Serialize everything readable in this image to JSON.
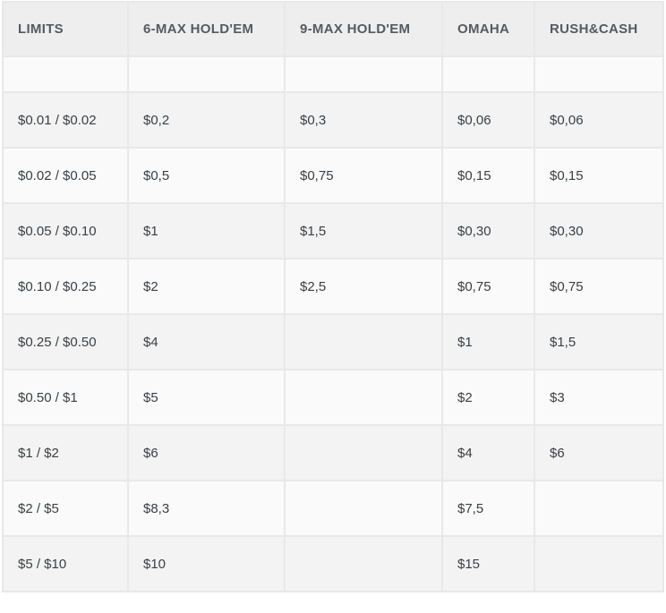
{
  "headers": [
    "LIMITS",
    "6-MAX HOLD'EM",
    "9-MAX HOLD'EM",
    "OMAHA",
    "RUSH&CASH"
  ],
  "rows": [
    [
      "$0.01 / $0.02",
      "$0,2",
      "$0,3",
      "$0,06",
      "$0,06"
    ],
    [
      "$0.02 / $0.05",
      "$0,5",
      "$0,75",
      "$0,15",
      "$0,15"
    ],
    [
      "$0.05 / $0.10",
      "$1",
      "$1,5",
      "$0,30",
      "$0,30"
    ],
    [
      "$0.10 / $0.25",
      "$2",
      "$2,5",
      "$0,75",
      "$0,75"
    ],
    [
      "$0.25 / $0.50",
      "$4",
      "",
      "$1",
      "$1,5"
    ],
    [
      "$0.50 / $1",
      "$5",
      "",
      "$2",
      "$3"
    ],
    [
      "$1 / $2",
      "$6",
      "",
      "$4",
      "$6"
    ],
    [
      "$2 / $5",
      "$8,3",
      "",
      "$7,5",
      ""
    ],
    [
      "$5 / $10",
      "$10",
      "",
      "$15",
      ""
    ]
  ]
}
